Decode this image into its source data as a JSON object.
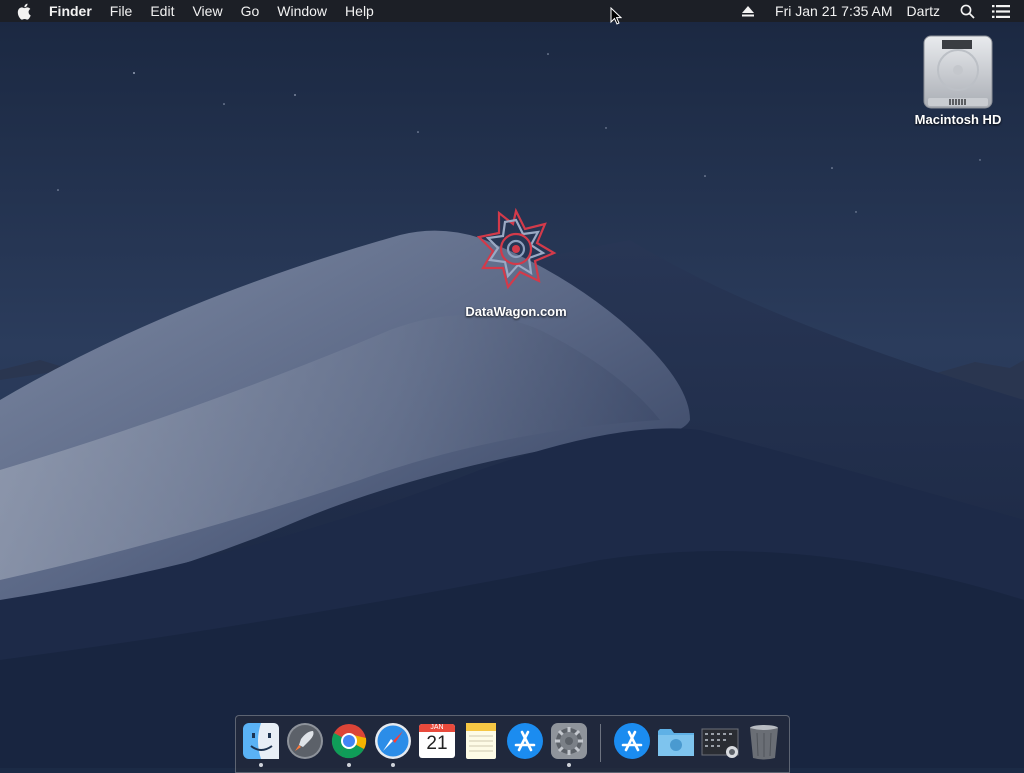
{
  "menubar": {
    "apple_icon": "apple-logo-icon",
    "app_name": "Finder",
    "menus": [
      "File",
      "Edit",
      "View",
      "Go",
      "Window",
      "Help"
    ],
    "eject_icon": "eject-icon",
    "clock": "Fri Jan 21  7:35 AM",
    "user": "Dartz",
    "search_icon": "spotlight-search-icon",
    "notification_icon": "notification-center-icon"
  },
  "desktop": {
    "drive": {
      "label": "Macintosh HD",
      "icon": "hard-drive-icon"
    },
    "shortcut": {
      "label": "DataWagon.com",
      "icon": "datawagon-logo-icon"
    }
  },
  "dock": {
    "apps": [
      {
        "name": "Finder",
        "icon": "finder-icon",
        "running": true
      },
      {
        "name": "Launchpad",
        "icon": "launchpad-rocket-icon",
        "running": false
      },
      {
        "name": "Google Chrome",
        "icon": "chrome-icon",
        "running": true
      },
      {
        "name": "Safari",
        "icon": "safari-compass-icon",
        "running": true
      },
      {
        "name": "Calendar",
        "icon": "calendar-icon",
        "running": false,
        "month": "JAN",
        "day": "21"
      },
      {
        "name": "Notes",
        "icon": "notes-icon",
        "running": false
      },
      {
        "name": "App Store",
        "icon": "app-store-icon",
        "running": false
      },
      {
        "name": "System Preferences",
        "icon": "system-preferences-gear-icon",
        "running": true
      }
    ],
    "stack_items": [
      {
        "name": "Applications",
        "icon": "applications-folder-icon"
      },
      {
        "name": "Downloads",
        "icon": "downloads-folder-icon"
      },
      {
        "name": "Screenshots",
        "icon": "screenshot-stack-icon"
      },
      {
        "name": "Trash",
        "icon": "trash-icon"
      }
    ]
  }
}
